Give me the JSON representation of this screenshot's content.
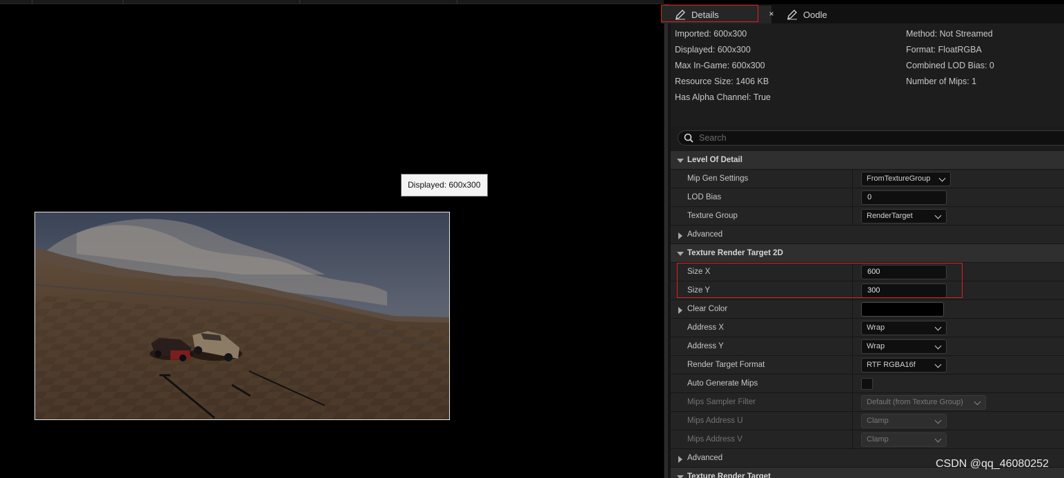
{
  "viewport": {
    "tooltip": "Displayed: 600x300"
  },
  "tabs": {
    "details_label": "Details",
    "close_glyph": "×",
    "oodle_label": "Oodle",
    "icon": "pencil-icon"
  },
  "info": {
    "left": [
      "Imported: 600x300",
      "Displayed: 600x300",
      "Max In-Game: 600x300",
      "Resource Size: 1406 KB",
      "Has Alpha Channel: True"
    ],
    "right": [
      "Method: Not Streamed",
      "Format: FloatRGBA",
      "Combined LOD Bias: 0",
      "Number of Mips: 1"
    ]
  },
  "search": {
    "placeholder": "Search"
  },
  "properties": {
    "level_of_detail": {
      "title": "Level Of Detail",
      "mip_gen_settings": {
        "label": "Mip Gen Settings",
        "value": "FromTextureGroup"
      },
      "lod_bias": {
        "label": "LOD Bias",
        "value": "0"
      },
      "texture_group": {
        "label": "Texture Group",
        "value": "RenderTarget"
      },
      "advanced": "Advanced"
    },
    "render_target_2d": {
      "title": "Texture Render Target 2D",
      "size_x": {
        "label": "Size X",
        "value": "600"
      },
      "size_y": {
        "label": "Size Y",
        "value": "300"
      },
      "clear_color": {
        "label": "Clear Color",
        "value": "#000000"
      },
      "address_x": {
        "label": "Address X",
        "value": "Wrap"
      },
      "address_y": {
        "label": "Address Y",
        "value": "Wrap"
      },
      "render_target_format": {
        "label": "Render Target Format",
        "value": "RTF RGBA16f"
      },
      "auto_generate_mips": {
        "label": "Auto Generate Mips",
        "value": false
      },
      "mips_sampler_filter": {
        "label": "Mips Sampler Filter",
        "value": "Default (from Texture Group)"
      },
      "mips_address_u": {
        "label": "Mips Address U",
        "value": "Clamp"
      },
      "mips_address_v": {
        "label": "Mips Address V",
        "value": "Clamp"
      },
      "advanced": "Advanced"
    },
    "render_target": {
      "title": "Texture Render Target"
    }
  },
  "watermark": "CSDN @qq_46080252",
  "colors": {
    "highlight": "#e02020",
    "panel_bg": "#1b1b1b",
    "row_bg": "#242424",
    "category_bg": "#2f2f2f"
  }
}
